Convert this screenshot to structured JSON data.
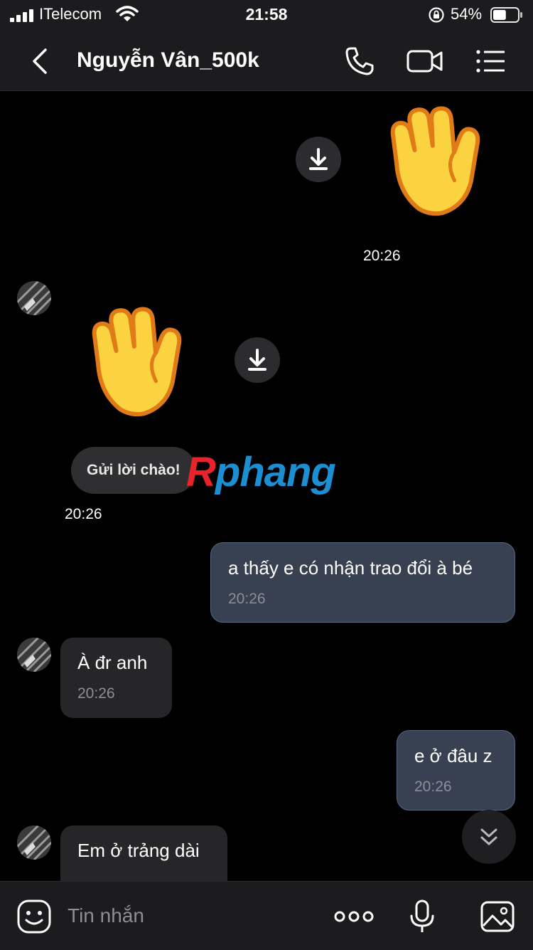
{
  "status_bar": {
    "carrier": "ITelecom",
    "time": "21:58",
    "battery": "54%",
    "battery_level": 0.54
  },
  "header": {
    "contact_name": "Nguyễn Vân_500k",
    "icons": [
      "back-chevron-icon",
      "phone-icon",
      "video-camera-icon",
      "menu-list-icon"
    ]
  },
  "messages": {
    "m1": {
      "type": "sticker",
      "sticker": "waving-hand",
      "time": "20:26"
    },
    "m2": {
      "type": "sticker",
      "sticker": "waving-hand",
      "greeting": "Gửi lời chào!",
      "time": "20:26"
    },
    "m3": {
      "text": "a thấy e có nhận trao đổi à bé",
      "time": "20:26"
    },
    "m4": {
      "text": "À đr anh",
      "time": "20:26"
    },
    "m5": {
      "text": "e ở đâu z",
      "time": "20:26"
    },
    "m6": {
      "text": "Em ở trảng dài"
    }
  },
  "watermark": {
    "part1": "R",
    "part2": "phang"
  },
  "composer": {
    "placeholder": "Tin nhắn",
    "icons": [
      "sticker-smile-icon",
      "more-dots-icon",
      "microphone-icon",
      "image-gallery-icon"
    ]
  },
  "colors": {
    "background": "#000000",
    "bar": "#1c1c1e",
    "outgoing_bubble": "#374152",
    "incoming_bubble": "#262628",
    "watermark_red": "#e8232b",
    "watermark_blue": "#1c8fd2"
  }
}
